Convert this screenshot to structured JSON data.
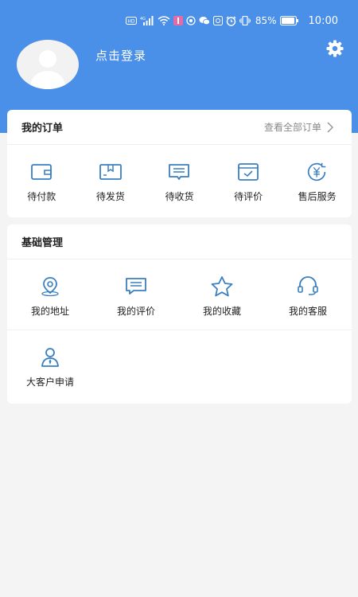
{
  "status_bar": {
    "battery_percent": "85%",
    "time": "10:00"
  },
  "profile": {
    "login_text": "点击登录"
  },
  "orders": {
    "title": "我的订单",
    "view_all": "查看全部订单",
    "items": [
      {
        "label": "待付款",
        "icon": "wallet-icon"
      },
      {
        "label": "待发货",
        "icon": "package-icon"
      },
      {
        "label": "待收货",
        "icon": "receive-icon"
      },
      {
        "label": "待评价",
        "icon": "review-icon"
      },
      {
        "label": "售后服务",
        "icon": "after-sale-icon"
      }
    ]
  },
  "basic": {
    "title": "基础管理",
    "items": [
      {
        "label": "我的地址",
        "icon": "location-icon"
      },
      {
        "label": "我的评价",
        "icon": "comment-icon"
      },
      {
        "label": "我的收藏",
        "icon": "star-icon"
      },
      {
        "label": "我的客服",
        "icon": "headset-icon"
      },
      {
        "label": "大客户申请",
        "icon": "vip-customer-icon"
      }
    ]
  },
  "colors": {
    "header_blue": "#4a8fe8",
    "icon_blue": "#3a7fc1",
    "background": "#f4f4f4"
  }
}
